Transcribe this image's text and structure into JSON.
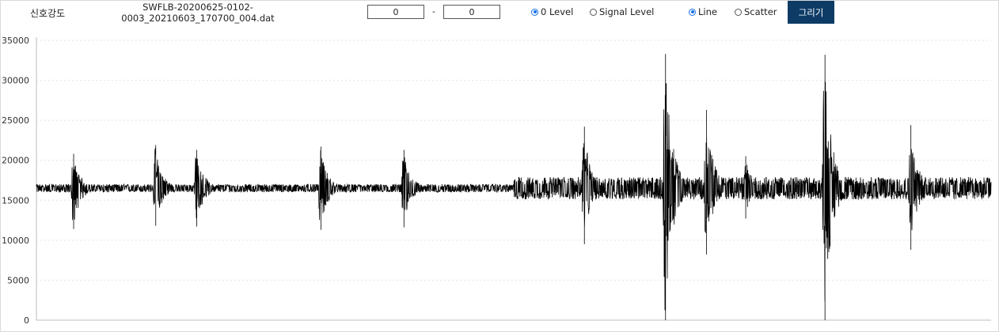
{
  "toolbar": {
    "title": "신호강도",
    "filename_line1": "SWFLB-20200625-0102-",
    "filename_line2": "0003_20210603_170700_004.dat",
    "range_start": "0",
    "range_sep": "-",
    "range_end": "0",
    "level_options": [
      {
        "label": "0 Level",
        "selected": true
      },
      {
        "label": "Signal Level",
        "selected": false
      }
    ],
    "mode_options": [
      {
        "label": "Line",
        "selected": true
      },
      {
        "label": "Scatter",
        "selected": false
      }
    ],
    "draw_label": "그리기"
  },
  "colors": {
    "accent": "#0d3b66",
    "radio": "#1a73e8",
    "signal": "#000000",
    "grid": "#e3e3e3"
  },
  "chart_data": {
    "type": "line",
    "title": "",
    "xlabel": "",
    "ylabel": "",
    "ylim": [
      0,
      35000
    ],
    "yticks": [
      0,
      5000,
      10000,
      15000,
      20000,
      25000,
      30000,
      35000
    ],
    "grid": "horizontal dotted",
    "legend": "none",
    "x_range": [
      0,
      1
    ],
    "baseline": 16500,
    "noise": [
      {
        "x_start": 0.0,
        "x_end": 0.5,
        "amp": 500
      },
      {
        "x_start": 0.5,
        "x_end": 1.0,
        "amp": 1400
      }
    ],
    "bursts": [
      {
        "x": 0.038,
        "max": 20800,
        "min": 11400
      },
      {
        "x": 0.124,
        "max": 21900,
        "min": 11800
      },
      {
        "x": 0.167,
        "max": 21300,
        "min": 11700
      },
      {
        "x": 0.297,
        "max": 21700,
        "min": 11300
      },
      {
        "x": 0.384,
        "max": 21300,
        "min": 11600
      },
      {
        "x": 0.573,
        "max": 24200,
        "min": 9500
      },
      {
        "x": 0.658,
        "max": 33300,
        "min": 0
      },
      {
        "x": 0.701,
        "max": 26300,
        "min": 8200
      },
      {
        "x": 0.742,
        "max": 20500,
        "min": 12700
      },
      {
        "x": 0.825,
        "max": 33200,
        "min": 0
      },
      {
        "x": 0.915,
        "max": 24400,
        "min": 8800
      }
    ]
  }
}
